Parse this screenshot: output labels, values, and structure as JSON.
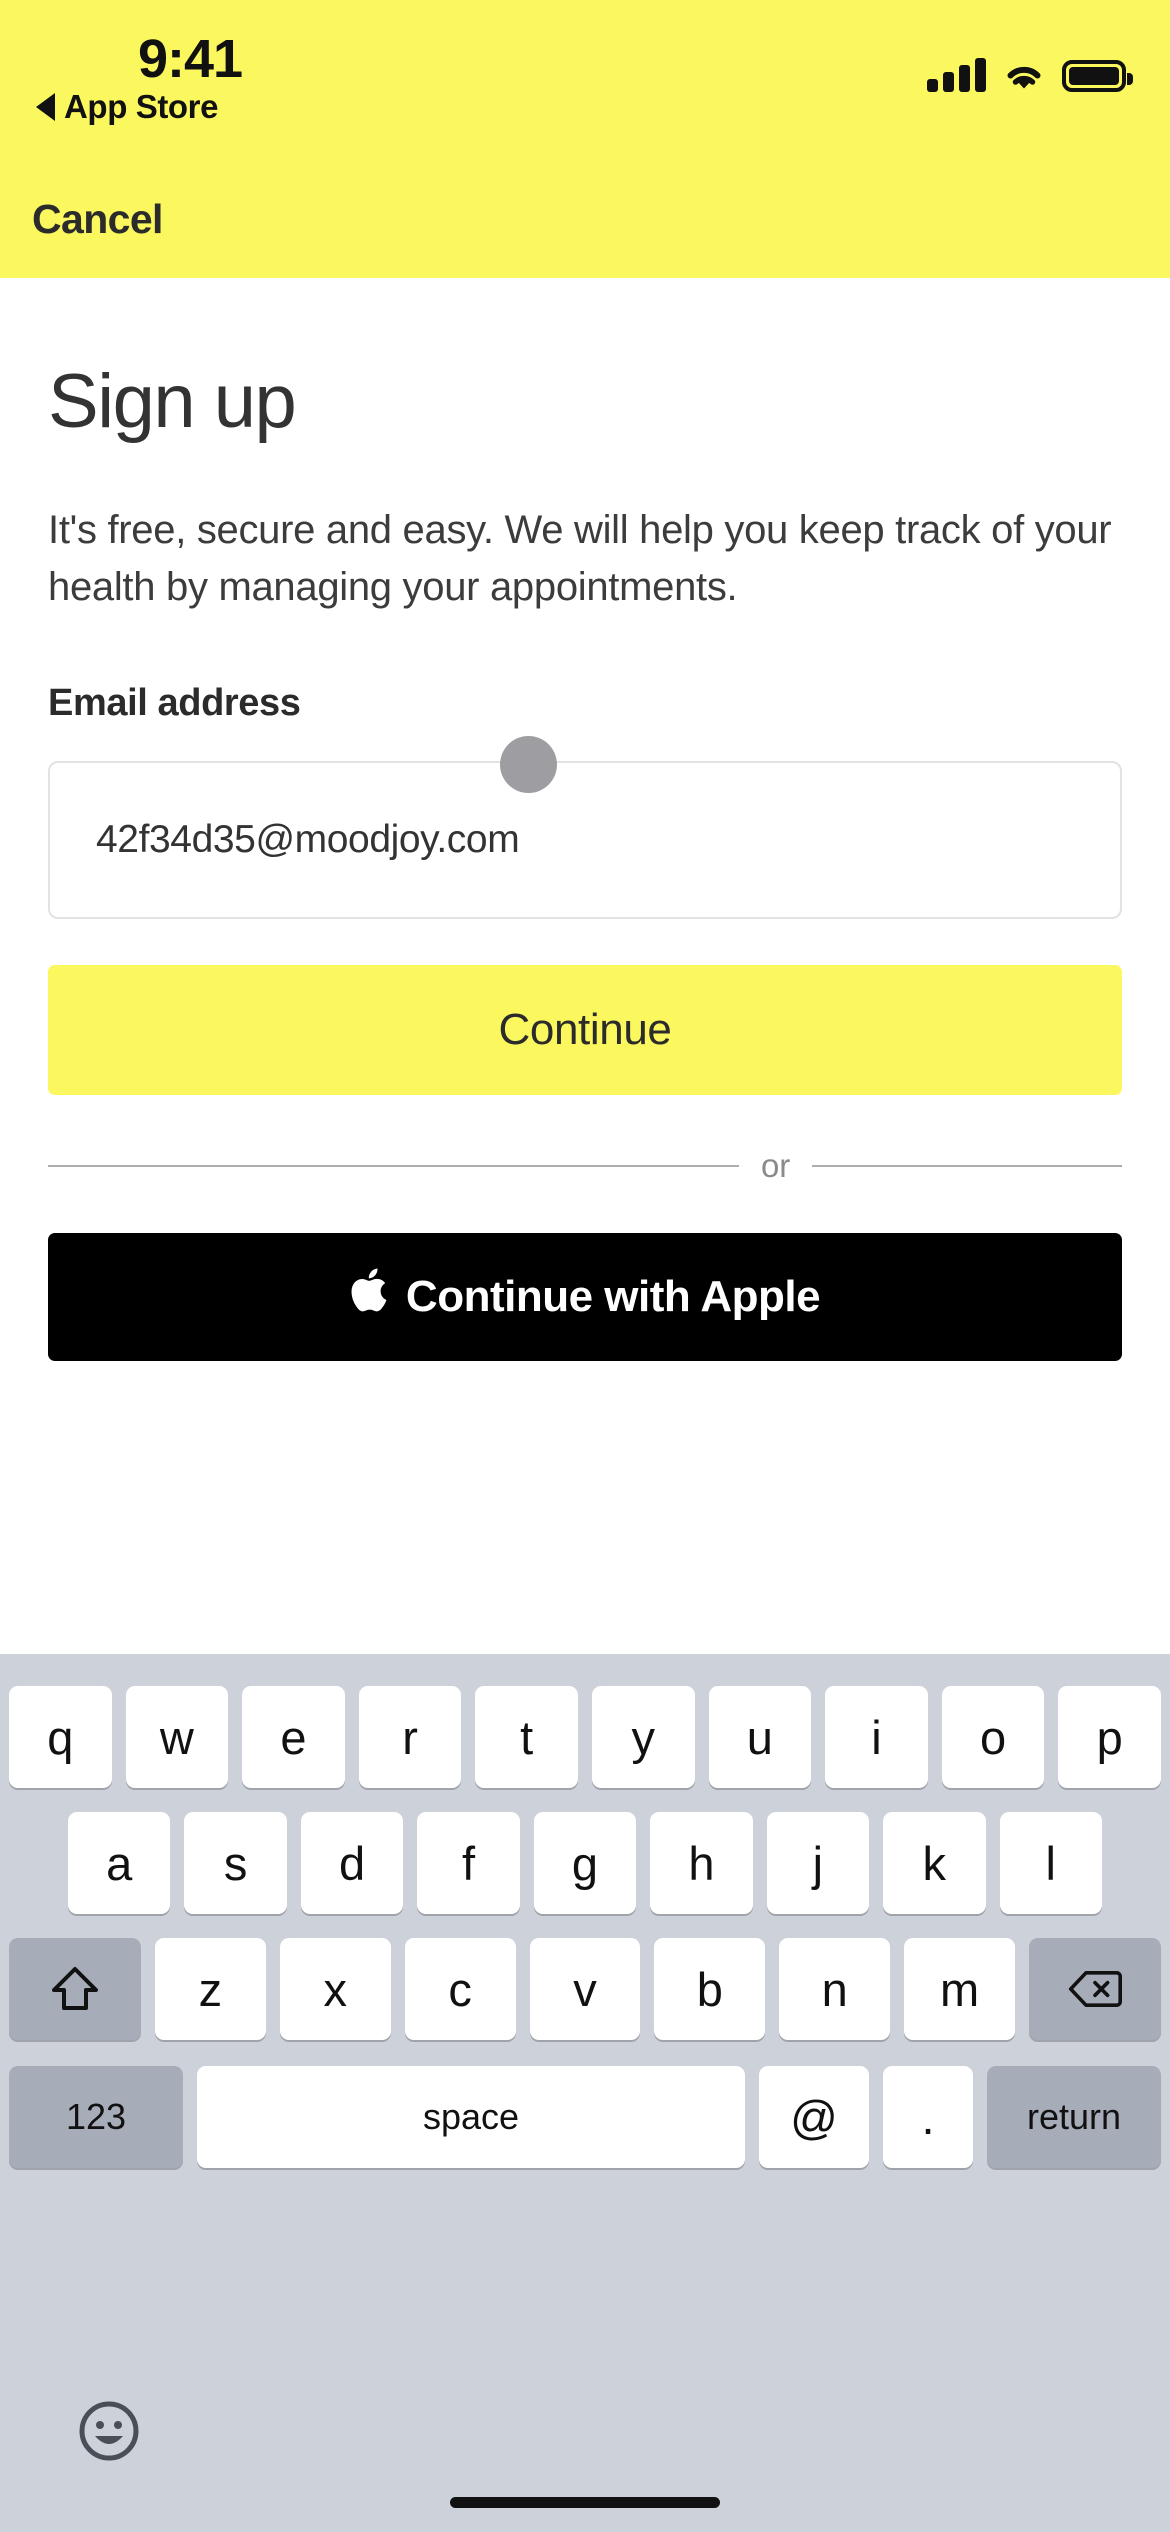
{
  "status_bar": {
    "time": "9:41",
    "back_label": "App Store",
    "back_icon": "triangle-left-icon",
    "signal_icon": "cellular-signal-icon",
    "wifi_icon": "wifi-icon",
    "battery_icon": "battery-full-icon"
  },
  "nav": {
    "cancel_label": "Cancel"
  },
  "screen": {
    "title": "Sign up",
    "intro": "It's free, secure and easy. We will help you keep track of your health by managing your appointments."
  },
  "form": {
    "email_label": "Email address",
    "email_value": "42f34d35@moodjoy.com",
    "email_placeholder": "Email address",
    "continue_label": "Continue",
    "divider_label": "or",
    "apple_label": "Continue with Apple",
    "apple_glyph": ""
  },
  "keyboard": {
    "row1": [
      "q",
      "w",
      "e",
      "r",
      "t",
      "y",
      "u",
      "i",
      "o",
      "p"
    ],
    "row2": [
      "a",
      "s",
      "d",
      "f",
      "g",
      "h",
      "j",
      "k",
      "l"
    ],
    "row3": [
      "z",
      "x",
      "c",
      "v",
      "b",
      "n",
      "m"
    ],
    "shift_icon": "shift-arrow-icon",
    "delete_icon": "backspace-icon",
    "numbers_label": "123",
    "space_label": "space",
    "at_label": "@",
    "dot_label": ".",
    "return_label": "return",
    "emoji_icon": "smiley-face-icon"
  },
  "colors": {
    "brand_yellow": "#FBF85F",
    "keyboard_bg": "#CDD1DA",
    "key_white": "#FFFFFF",
    "key_gray": "#A7ACB9",
    "text_dark": "#2B2B2B",
    "touch_dot": "#9D9DA2"
  }
}
